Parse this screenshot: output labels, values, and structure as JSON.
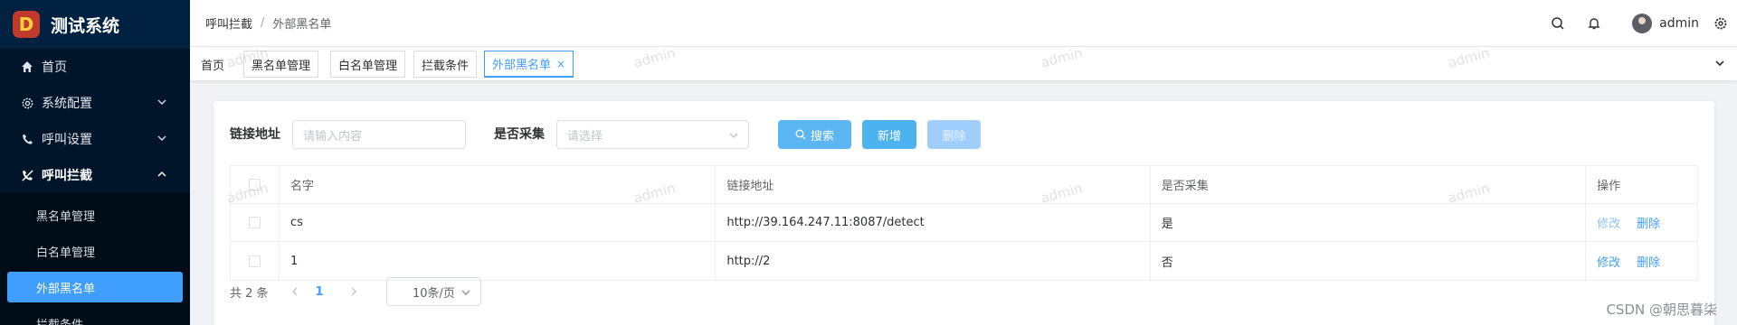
{
  "app": {
    "title": "测试系统",
    "logo_letter": "D"
  },
  "sidebar": {
    "items": [
      {
        "label": "首页",
        "icon": "home-icon"
      },
      {
        "label": "系统配置",
        "icon": "gear-icon"
      },
      {
        "label": "呼叫设置",
        "icon": "phone-icon"
      },
      {
        "label": "呼叫拦截",
        "icon": "phone-blocked-icon"
      }
    ],
    "sub_items": [
      {
        "label": "黑名单管理"
      },
      {
        "label": "白名单管理"
      },
      {
        "label": "外部黑名单"
      },
      {
        "label": "拦截条件"
      }
    ]
  },
  "header": {
    "breadcrumb": [
      "呼叫拦截",
      "外部黑名单"
    ],
    "separator": "/",
    "user": "admin"
  },
  "tabs": [
    {
      "label": "首页"
    },
    {
      "label": "黑名单管理"
    },
    {
      "label": "白名单管理"
    },
    {
      "label": "拦截条件"
    },
    {
      "label": "外部黑名单",
      "close": "×"
    }
  ],
  "filters": {
    "link_label": "链接地址",
    "link_placeholder": "请输入内容",
    "collect_label": "是否采集",
    "collect_placeholder": "请选择"
  },
  "buttons": {
    "search": "搜索",
    "add": "新增",
    "delete": "删除"
  },
  "table": {
    "columns": [
      "名字",
      "链接地址",
      "是否采集",
      "操作"
    ],
    "rows": [
      {
        "name": "cs",
        "url": "http://39.164.247.11:8087/detect",
        "collect": "是",
        "edit": "修改",
        "delete": "删除"
      },
      {
        "name": "1",
        "url": "http://2",
        "collect": "否",
        "edit": "修改",
        "delete": "删除"
      }
    ]
  },
  "pagination": {
    "total": "共 2 条",
    "current": "1",
    "page_size": "10条/页"
  },
  "watermark_text": "admin",
  "footer_credit": "CSDN @朝思暮柒",
  "colors": {
    "primary": "#409eff",
    "sidebar": "#001529",
    "active_menu": "#409eff"
  }
}
